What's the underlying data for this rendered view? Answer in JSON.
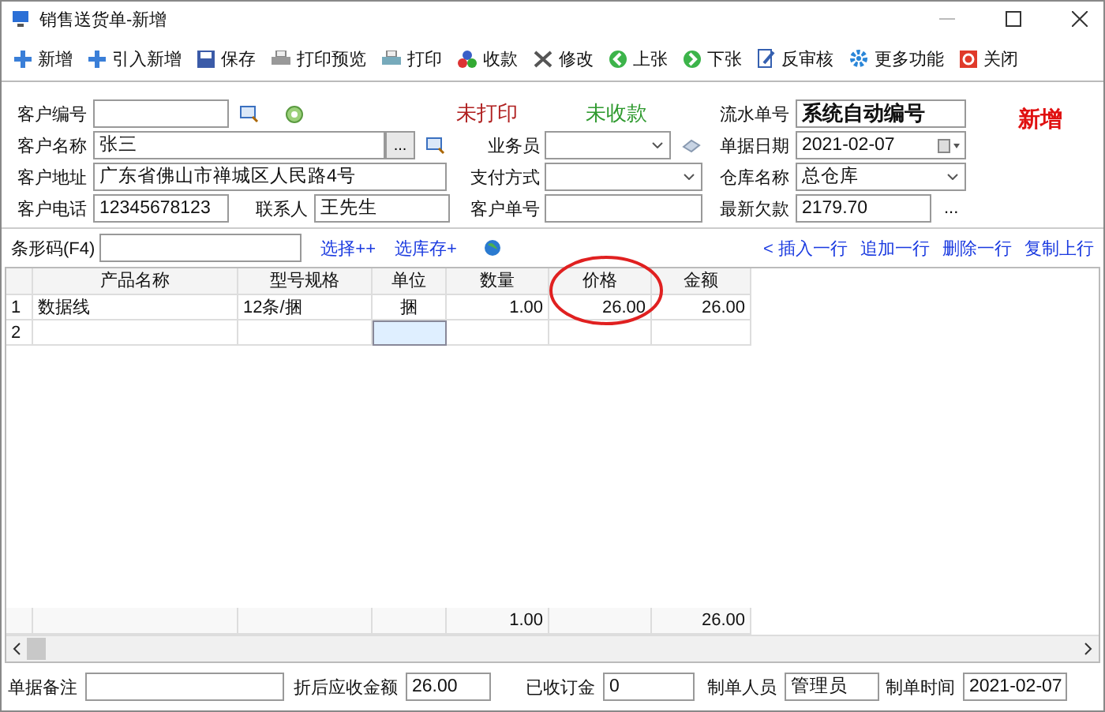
{
  "window": {
    "title": "销售送货单-新增"
  },
  "toolbar": [
    "新增",
    "引入新增",
    "保存",
    "打印预览",
    "打印",
    "收款",
    "修改",
    "上张",
    "下张",
    "反审核",
    "更多功能",
    "关闭"
  ],
  "form": {
    "customer_code": {
      "label": "客户编号"
    },
    "print_status": "未打印",
    "payment_status": "未收款",
    "serial_no": {
      "label": "流水单号",
      "value": "系统自动编号"
    },
    "mode": "新增",
    "customer_name": {
      "label": "客户名称",
      "value": "张三",
      "button": "..."
    },
    "salesperson": {
      "label": "业务员"
    },
    "doc_date": {
      "label": "单据日期",
      "value": "2021-02-07"
    },
    "address": {
      "label": "客户地址",
      "value": "广东省佛山市禅城区人民路4号"
    },
    "payment_method": {
      "label": "支付方式"
    },
    "warehouse": {
      "label": "仓库名称",
      "value": "总仓库"
    },
    "phone": {
      "label": "客户电话",
      "value": "12345678123"
    },
    "contact": {
      "label": "联系人",
      "value": "王先生"
    },
    "customer_order_no": {
      "label": "客户单号"
    },
    "latest_debt": {
      "label": "最新欠款",
      "value": "2179.70",
      "button": "..."
    }
  },
  "barcode": {
    "label": "条形码(F4)",
    "links": [
      "选择++",
      "选库存+"
    ]
  },
  "row_actions": [
    "< 插入一行",
    "追加一行",
    "删除一行",
    "复制上行"
  ],
  "table": {
    "columns": [
      "产品名称",
      "型号规格",
      "单位",
      "数量",
      "价格",
      "金额"
    ],
    "rows": [
      {
        "number": "1",
        "cells": [
          {
            "text": "数据线",
            "selected": false
          },
          {
            "text": "12条/捆",
            "selected": false
          },
          {
            "text": "捆",
            "selected": false
          },
          {
            "text": "1.00",
            "selected": false
          },
          {
            "text": "26.00",
            "selected": false
          },
          {
            "text": "26.00",
            "selected": false
          }
        ]
      },
      {
        "number": "2",
        "cells": [
          {
            "selected": false
          },
          {
            "selected": false
          },
          {
            "selected": true
          },
          {
            "selected": false
          },
          {
            "selected": false
          },
          {
            "selected": false
          }
        ]
      }
    ],
    "totals": {
      "quantity": "1.00",
      "amount": "26.00"
    }
  },
  "footer": [
    {
      "label": "单据备注"
    },
    {
      "label": "折后应收金额",
      "value": "26.00"
    },
    {
      "label": "已收订金",
      "value": "0"
    },
    {
      "label": "制单人员",
      "value": "管理员"
    },
    {
      "label": "制单时间",
      "value": "2021-02-07"
    }
  ]
}
